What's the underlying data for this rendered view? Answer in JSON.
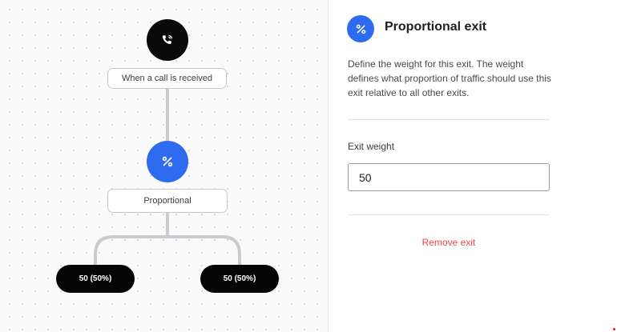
{
  "canvas": {
    "trigger_node": {
      "label": "When a call is received",
      "icon": "phone-incoming-icon"
    },
    "proportional_node": {
      "label": "Proportional",
      "icon": "percent-icon"
    },
    "exits": [
      {
        "label": "50 (50%)"
      },
      {
        "label": "50 (50%)"
      }
    ]
  },
  "panel": {
    "icon": "percent-icon",
    "title": "Proportional exit",
    "description": "Define the weight for this exit. The weight defines what proportion of traffic should use this exit relative to all other exits.",
    "field_label": "Exit weight",
    "weight_value": "50",
    "remove_label": "Remove exit"
  },
  "colors": {
    "accent": "#2f6bf0",
    "danger": "#f04747",
    "node_dark": "#0a0a0a",
    "connector": "#c8ccd1"
  }
}
